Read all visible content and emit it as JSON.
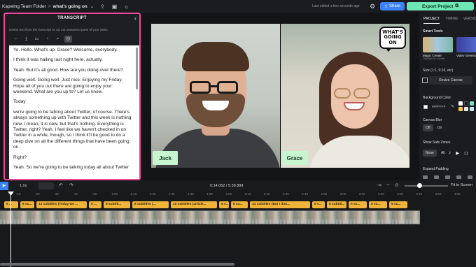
{
  "topbar": {
    "folder": "Kapwing Team Folder",
    "separator": ">",
    "project": "what's going on",
    "dropdown_icon": "chevron-down-icon",
    "saved_text": "Last edited a few seconds ago",
    "share_label": "Share",
    "export_label": "Export Project"
  },
  "transcript": {
    "title": "TRANSCRIPT",
    "hint": "Delete text from the transcript to cut out unwanted parts of your video.",
    "paragraphs": [
      "Yo. Hello. What's up, Grace? Welcome, everybody.",
      "I think it was hailing last night here, actually.",
      "Yeah. But it's all good. How are you doing over there?",
      "Going well. Going well. Just nice. Enjoying my Friday. Hope all of you out there are going to enjoy your weekend. What are you up to? Let us know.",
      "Today",
      "we're going to be talking about Twitter, of course. There's always something up with Twitter and this week is nothing new. I mean, it is new, but that's nothing. Everything is Twitter, right? Yeah. I feel like we haven't checked in on Twitter in a while, though, so I think it'll be good to do a deep dive on all the different things that have been going on.",
      "Right?",
      "Yeah. So we're going to be talking today all about Twitter"
    ]
  },
  "preview": {
    "badge": "WHAT'S GOING ON",
    "left_name": "Jack",
    "right_name": "Grace"
  },
  "right_panel": {
    "tabs": [
      "PROJECT",
      "TIMING",
      "VERSIONS"
    ],
    "smart_tools_label": "Smart Tools",
    "tool_a": "Magic Create",
    "tool_a_sub": "Optimize for socials",
    "tool_b": "Video Generat",
    "size_label": "Size (1:1, 9:16, etc)",
    "resize_label": "Resize Canvas",
    "bg_label": "Background Color",
    "bg_value": "#FFFFFF",
    "blur_label": "Canvas Blur",
    "blur_off": "Off",
    "blur_on": "On",
    "safe_label": "Show Safe Zones",
    "safe_none": "None",
    "safe_all": "All",
    "padding_label": "Expand Padding",
    "palette": [
      "#ffffff",
      "#1a1a1a",
      "#7bdcc5",
      "#f5c542",
      "#e8e8e8",
      "#bfe7ff"
    ]
  },
  "playback": {
    "speed": "1.0x",
    "timecode": "0:14.062 / 5:39.899",
    "fit_label": "Fit to Screen"
  },
  "timeline": {
    "ruler_ticks": [
      ":10",
      ":20",
      ":30",
      ":40",
      ":50",
      "1:00",
      "1:10",
      "1:20",
      "1:30",
      "1:40",
      "1:50",
      "2:00",
      "2:10",
      "2:20",
      "2:30",
      "2:40",
      "2:50",
      "3:00",
      "3:10",
      "3:20",
      "3:30",
      "3:40",
      "3:50",
      "4:00"
    ],
    "chips": [
      "5 ...",
      "6 su...",
      "13 subtitles (Today we ...",
      "5 ...",
      "8 subtitl...",
      "8 subtitles (...",
      "10 subtitles (article...",
      "5 s...",
      "6 su...",
      "14 subtitles (But I don...",
      "5 s...",
      "5 subtitl...",
      "5 su...",
      "5 su...",
      "5 su...",
      "5 s..."
    ]
  }
}
